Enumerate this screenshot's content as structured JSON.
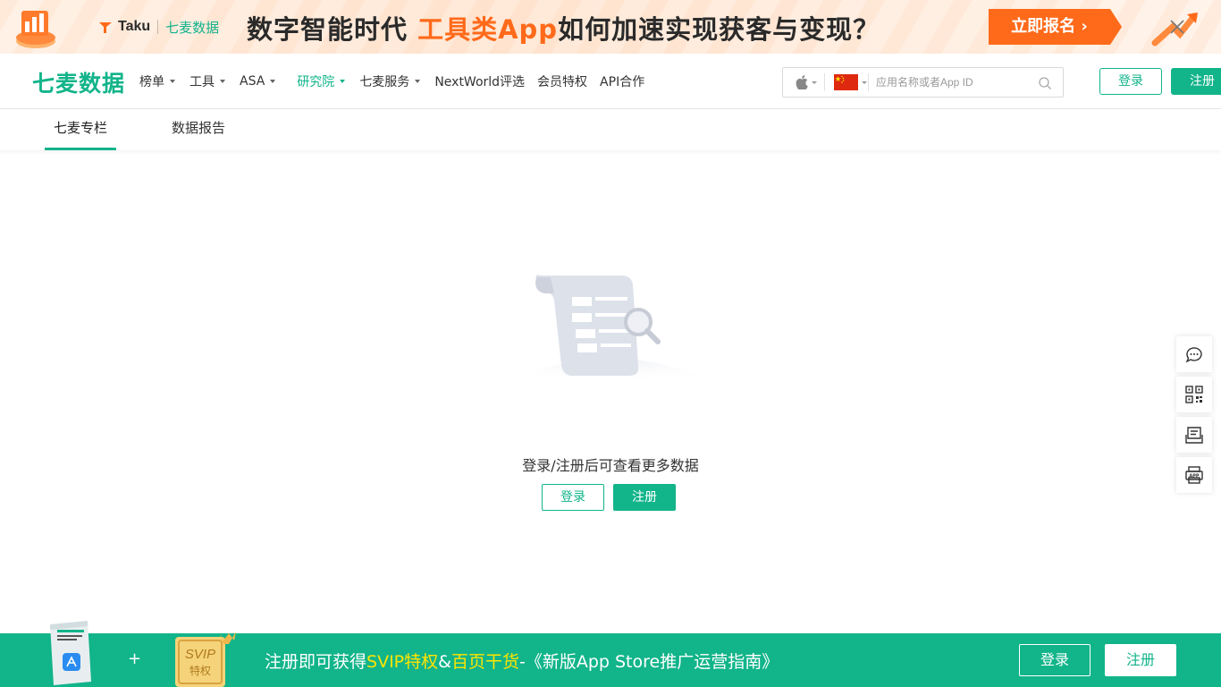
{
  "banner": {
    "partner": "Taku",
    "brand": "七麦数据",
    "headline_pre": "数字智能时代 ",
    "headline_highlight": "工具类App",
    "headline_post": "如何加速实现获客与变现？",
    "cta": "立即报名",
    "cta_arrow": "›",
    "colors": {
      "accent": "#ff6a1a"
    }
  },
  "nav": {
    "brand": "七麦数据",
    "items": [
      {
        "label": "榜单",
        "dropdown": true
      },
      {
        "label": "工具",
        "dropdown": true
      },
      {
        "label": "ASA",
        "dropdown": true
      },
      {
        "label": "研究院",
        "dropdown": true,
        "active": true
      },
      {
        "label": "七麦服务",
        "dropdown": true
      },
      {
        "label": "NextWorld评选",
        "dropdown": false
      },
      {
        "label": "会员特权",
        "dropdown": false
      },
      {
        "label": "API合作",
        "dropdown": false
      }
    ],
    "search": {
      "placeholder": "应用名称或者App ID",
      "value": "",
      "platform_icon": "apple-icon",
      "country_icon": "china-flag-icon"
    },
    "login": "登录",
    "register": "注册",
    "colors": {
      "brand": "#12b48a"
    }
  },
  "subtabs": [
    {
      "label": "七麦专栏",
      "active": true
    },
    {
      "label": "数据报告",
      "active": false
    }
  ],
  "empty": {
    "message": "登录/注册后可查看更多数据",
    "login": "登录",
    "register": "注册"
  },
  "side_tools": [
    "chat-icon",
    "qrcode-icon",
    "feedback-icon",
    "app-download-icon"
  ],
  "promo": {
    "plus": "+",
    "svip_badge": "SVIP",
    "svip_badge_sub": "特权",
    "text_1": "注册即可获得",
    "text_svip": "SVIP特权",
    "text_amp": "&",
    "text_goods": "百页干货",
    "text_2": "-《新版App Store推广运营指南》",
    "login": "登录",
    "register": "注册"
  }
}
